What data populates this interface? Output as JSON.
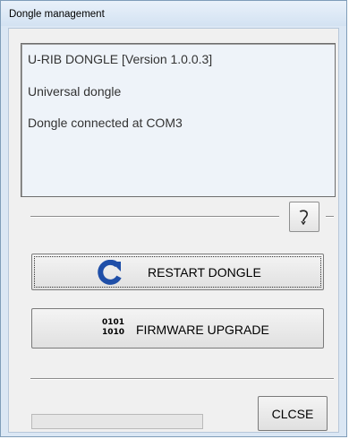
{
  "window": {
    "title": "Dongle management"
  },
  "info": {
    "line1": "U-RIB DONGLE  [Version 1.0.0.3]",
    "line2": "Universal dongle",
    "line3": "Dongle connected at COM3"
  },
  "toolbar": {
    "tool_button_icon": "wand-icon"
  },
  "buttons": {
    "restart_label": "RESTART DONGLE",
    "restart_icon": "refresh-icon",
    "firmware_label": "FIRMWARE UPGRADE",
    "firmware_icon_line1": "0101",
    "firmware_icon_line2": "1010",
    "close_label": "CLCSE"
  },
  "progress": {
    "value": 0
  },
  "colors": {
    "refresh_icon": "#1f4fa8",
    "window_border": "#7f9db9"
  }
}
